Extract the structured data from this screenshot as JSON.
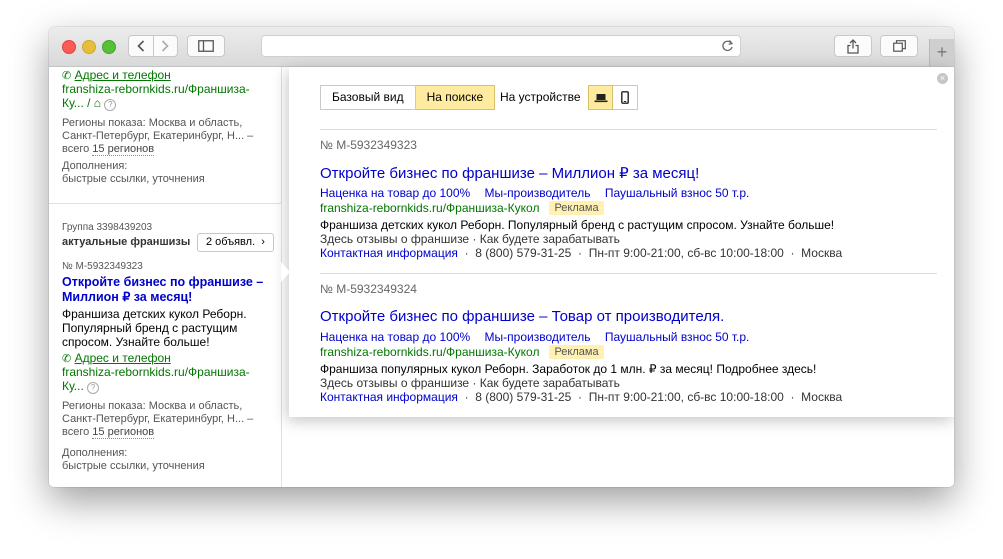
{
  "sidebar": {
    "card1": {
      "contact_link": "Адрес и телефон",
      "display_url": "franshiza-rebornkids.ru/Франшиза-Ку...",
      "regions_label": "Регионы показа:",
      "regions_line1": "Москва и область,",
      "regions_line2": "Санкт-Петербург, Екатеринбург, Н... –",
      "regions_total_prefix": "всего",
      "regions_count_link": "15 регионов",
      "extras_label": "Дополнения:",
      "extras_value": "быстрые ссылки, уточнения"
    },
    "group": {
      "id_label": "Группа 3398439203",
      "name": "актуальные франшизы",
      "count_button": "2 объявл."
    },
    "card2": {
      "ad_number": "№ M-5932349323",
      "title_line1": "Откройте бизнес по франшизе –",
      "title_line2": "Миллион ₽ за месяц!",
      "desc_line1": "Франшиза детских кукол Реборн.",
      "desc_line2": "Популярный бренд с растущим",
      "desc_line3": "спросом. Узнайте больше!",
      "contact_link": "Адрес и телефон",
      "display_url_line1": "franshiza-rebornkids.ru/Франшиза-",
      "display_url_line2": "Ку...",
      "regions_label": "Регионы показа:",
      "regions_line1": "Москва и область,",
      "regions_line2": "Санкт-Петербург, Екатеринбург, Н... –",
      "regions_total_prefix": "всего",
      "regions_count_link": "15 регионов",
      "extras_label": "Дополнения:",
      "extras_value": "быстрые ссылки, уточнения"
    }
  },
  "preview": {
    "view_tabs": [
      "Базовый вид",
      "На поиске"
    ],
    "active_tab": "На поиске",
    "device_label": "На устройстве",
    "device_options": [
      "laptop-icon",
      "phone-icon"
    ],
    "ads": [
      {
        "number": "№ M-5932349323",
        "title": "Откройте бизнес по франшизе – Миллион ₽ за месяц!",
        "sitelinks": [
          "Наценка на товар до 100%",
          "Мы-производитель",
          "Паушальный взнос 50 т.р."
        ],
        "url": "franshiza-rebornkids.ru/Франшиза-Кукол",
        "badge": "Реклама",
        "description": "Франшиза детских кукол Реборн. Популярный бренд с растущим спросом. Узнайте больше!",
        "callouts": "Здесь отзывы о франшизе  ·  Как будете зарабатывать",
        "contact_link": "Контактная информация",
        "phone": "8 (800) 579-31-25",
        "hours": "Пн-пт 9:00-21:00, сб-вс 10:00-18:00",
        "city": "Москва"
      },
      {
        "number": "№ M-5932349324",
        "title": "Откройте бизнес по франшизе – Товар от производителя.",
        "sitelinks": [
          "Наценка на товар до 100%",
          "Мы-производитель",
          "Паушальный взнос 50 т.р."
        ],
        "url": "franshiza-rebornkids.ru/Франшиза-Кукол",
        "badge": "Реклама",
        "description": "Франшиза популярных кукол Реборн. Заработок до 1 млн. ₽ за месяц! Подробнее здесь!",
        "callouts": "Здесь отзывы о франшизе  ·  Как будете зарабатывать",
        "contact_link": "Контактная информация",
        "phone": "8 (800) 579-31-25",
        "hours": "Пн-пт 9:00-21:00, сб-вс 10:00-18:00",
        "city": "Москва"
      }
    ]
  },
  "colors": {
    "link": "#0000cc",
    "url_green": "#007700",
    "active_tab": "#ffeba0",
    "badge": "#fff1b3"
  }
}
